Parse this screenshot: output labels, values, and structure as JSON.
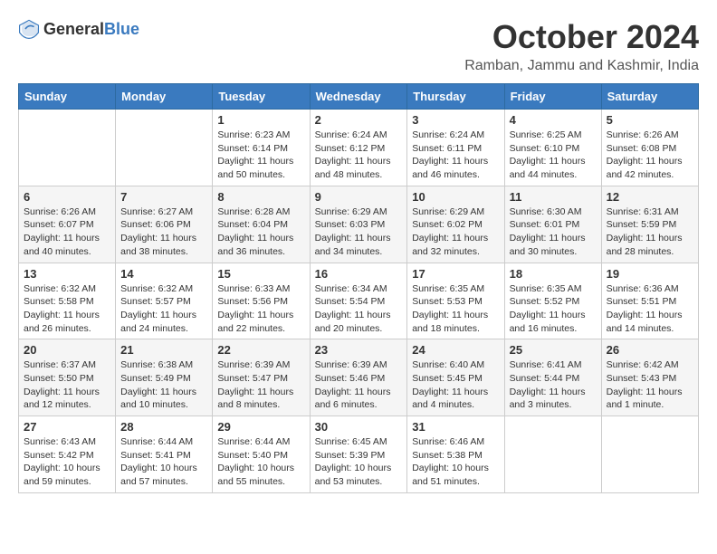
{
  "header": {
    "logo_general": "General",
    "logo_blue": "Blue",
    "month": "October 2024",
    "location": "Ramban, Jammu and Kashmir, India"
  },
  "calendar": {
    "days_of_week": [
      "Sunday",
      "Monday",
      "Tuesday",
      "Wednesday",
      "Thursday",
      "Friday",
      "Saturday"
    ],
    "weeks": [
      [
        {
          "day": "",
          "info": ""
        },
        {
          "day": "",
          "info": ""
        },
        {
          "day": "1",
          "info": "Sunrise: 6:23 AM\nSunset: 6:14 PM\nDaylight: 11 hours and 50 minutes."
        },
        {
          "day": "2",
          "info": "Sunrise: 6:24 AM\nSunset: 6:12 PM\nDaylight: 11 hours and 48 minutes."
        },
        {
          "day": "3",
          "info": "Sunrise: 6:24 AM\nSunset: 6:11 PM\nDaylight: 11 hours and 46 minutes."
        },
        {
          "day": "4",
          "info": "Sunrise: 6:25 AM\nSunset: 6:10 PM\nDaylight: 11 hours and 44 minutes."
        },
        {
          "day": "5",
          "info": "Sunrise: 6:26 AM\nSunset: 6:08 PM\nDaylight: 11 hours and 42 minutes."
        }
      ],
      [
        {
          "day": "6",
          "info": "Sunrise: 6:26 AM\nSunset: 6:07 PM\nDaylight: 11 hours and 40 minutes."
        },
        {
          "day": "7",
          "info": "Sunrise: 6:27 AM\nSunset: 6:06 PM\nDaylight: 11 hours and 38 minutes."
        },
        {
          "day": "8",
          "info": "Sunrise: 6:28 AM\nSunset: 6:04 PM\nDaylight: 11 hours and 36 minutes."
        },
        {
          "day": "9",
          "info": "Sunrise: 6:29 AM\nSunset: 6:03 PM\nDaylight: 11 hours and 34 minutes."
        },
        {
          "day": "10",
          "info": "Sunrise: 6:29 AM\nSunset: 6:02 PM\nDaylight: 11 hours and 32 minutes."
        },
        {
          "day": "11",
          "info": "Sunrise: 6:30 AM\nSunset: 6:01 PM\nDaylight: 11 hours and 30 minutes."
        },
        {
          "day": "12",
          "info": "Sunrise: 6:31 AM\nSunset: 5:59 PM\nDaylight: 11 hours and 28 minutes."
        }
      ],
      [
        {
          "day": "13",
          "info": "Sunrise: 6:32 AM\nSunset: 5:58 PM\nDaylight: 11 hours and 26 minutes."
        },
        {
          "day": "14",
          "info": "Sunrise: 6:32 AM\nSunset: 5:57 PM\nDaylight: 11 hours and 24 minutes."
        },
        {
          "day": "15",
          "info": "Sunrise: 6:33 AM\nSunset: 5:56 PM\nDaylight: 11 hours and 22 minutes."
        },
        {
          "day": "16",
          "info": "Sunrise: 6:34 AM\nSunset: 5:54 PM\nDaylight: 11 hours and 20 minutes."
        },
        {
          "day": "17",
          "info": "Sunrise: 6:35 AM\nSunset: 5:53 PM\nDaylight: 11 hours and 18 minutes."
        },
        {
          "day": "18",
          "info": "Sunrise: 6:35 AM\nSunset: 5:52 PM\nDaylight: 11 hours and 16 minutes."
        },
        {
          "day": "19",
          "info": "Sunrise: 6:36 AM\nSunset: 5:51 PM\nDaylight: 11 hours and 14 minutes."
        }
      ],
      [
        {
          "day": "20",
          "info": "Sunrise: 6:37 AM\nSunset: 5:50 PM\nDaylight: 11 hours and 12 minutes."
        },
        {
          "day": "21",
          "info": "Sunrise: 6:38 AM\nSunset: 5:49 PM\nDaylight: 11 hours and 10 minutes."
        },
        {
          "day": "22",
          "info": "Sunrise: 6:39 AM\nSunset: 5:47 PM\nDaylight: 11 hours and 8 minutes."
        },
        {
          "day": "23",
          "info": "Sunrise: 6:39 AM\nSunset: 5:46 PM\nDaylight: 11 hours and 6 minutes."
        },
        {
          "day": "24",
          "info": "Sunrise: 6:40 AM\nSunset: 5:45 PM\nDaylight: 11 hours and 4 minutes."
        },
        {
          "day": "25",
          "info": "Sunrise: 6:41 AM\nSunset: 5:44 PM\nDaylight: 11 hours and 3 minutes."
        },
        {
          "day": "26",
          "info": "Sunrise: 6:42 AM\nSunset: 5:43 PM\nDaylight: 11 hours and 1 minute."
        }
      ],
      [
        {
          "day": "27",
          "info": "Sunrise: 6:43 AM\nSunset: 5:42 PM\nDaylight: 10 hours and 59 minutes."
        },
        {
          "day": "28",
          "info": "Sunrise: 6:44 AM\nSunset: 5:41 PM\nDaylight: 10 hours and 57 minutes."
        },
        {
          "day": "29",
          "info": "Sunrise: 6:44 AM\nSunset: 5:40 PM\nDaylight: 10 hours and 55 minutes."
        },
        {
          "day": "30",
          "info": "Sunrise: 6:45 AM\nSunset: 5:39 PM\nDaylight: 10 hours and 53 minutes."
        },
        {
          "day": "31",
          "info": "Sunrise: 6:46 AM\nSunset: 5:38 PM\nDaylight: 10 hours and 51 minutes."
        },
        {
          "day": "",
          "info": ""
        },
        {
          "day": "",
          "info": ""
        }
      ]
    ]
  }
}
